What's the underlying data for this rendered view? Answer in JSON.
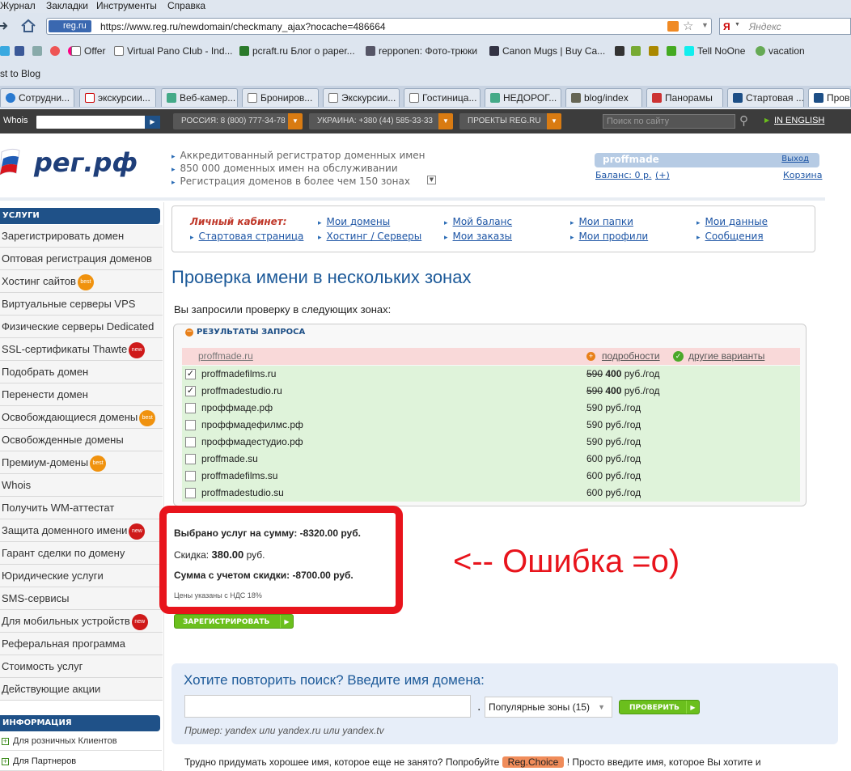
{
  "menu": [
    "Журнал",
    "Закладки",
    "Инструменты",
    "Справка"
  ],
  "nav": {
    "site_id": "reg.ru",
    "url": "https://www.reg.ru/newdomain/checkmany_ajax?nocache=486664",
    "search_placeholder": "Яндекс"
  },
  "bookmarks": [
    "Offer",
    "Virtual Pano Club - Ind...",
    "pcraft.ru Блог о paper...",
    "repponen: Фото-трюки",
    "Canon Mugs | Buy Ca...",
    "Tell NoOne",
    "vacation"
  ],
  "bookmarks_row2": "st to Blog",
  "tabs": [
    "Сотрудни...",
    "экскурсии...",
    "Веб-камер...",
    "Брониров...",
    "Экскурсии...",
    "Гостиница...",
    "НЕДОРОГ...",
    "blog/index",
    "Панорамы",
    "Стартовая ...",
    "Пров"
  ],
  "sitebar": {
    "whois": "Whois",
    "russia": "РОССИЯ: 8 (800) 777-34-78",
    "ukraine": "УКРАИНА: +380 (44) 585-33-33",
    "projects": "ПРОЕКТЫ REG.RU",
    "search_placeholder": "Поиск по сайту",
    "english": "IN ENGLISH"
  },
  "header": {
    "logo_text": "рег.рф",
    "lines": [
      "Аккредитованный регистратор доменных имен",
      "850 000 доменных имен на обслуживании",
      "Регистрация доменов в более чем 150 зонах"
    ],
    "username": "proffmade",
    "logout": "Выход",
    "balance": "Баланс: 0 р.",
    "balance_plus": "(+)",
    "cart": "Корзина"
  },
  "sidebar": {
    "services_title": "УСЛУГИ",
    "items": [
      {
        "label": "Зарегистрировать домен",
        "badge": ""
      },
      {
        "label": "Оптовая регистрация доменов",
        "badge": ""
      },
      {
        "label": "Хостинг сайтов",
        "badge": "best"
      },
      {
        "label": "Виртуальные серверы VPS",
        "badge": ""
      },
      {
        "label": "Физические серверы Dedicated",
        "badge": ""
      },
      {
        "label": "SSL-сертификаты Thawte",
        "badge": "new"
      },
      {
        "label": "Подобрать домен",
        "badge": ""
      },
      {
        "label": "Перенести домен",
        "badge": ""
      },
      {
        "label": "Освобождающиеся домены",
        "badge": "best"
      },
      {
        "label": "Освобожденные домены",
        "badge": ""
      },
      {
        "label": "Премиум-домены",
        "badge": "best"
      },
      {
        "label": "Whois",
        "badge": ""
      },
      {
        "label": "Получить WM-аттестат",
        "badge": ""
      },
      {
        "label": "Защита доменного имени",
        "badge": "new"
      },
      {
        "label": "Гарант сделки по домену",
        "badge": ""
      },
      {
        "label": "Юридические услуги",
        "badge": ""
      },
      {
        "label": "SMS-сервисы",
        "badge": ""
      },
      {
        "label": "Для мобильных устройств",
        "badge": "new"
      },
      {
        "label": "Реферальная программа",
        "badge": ""
      },
      {
        "label": "Стоимость услуг",
        "badge": ""
      },
      {
        "label": "Действующие акции",
        "badge": ""
      }
    ],
    "info_title": "ИНФОРМАЦИЯ",
    "info_items": [
      "Для розничных Клиентов",
      "Для Партнеров"
    ]
  },
  "cabinet": {
    "title": "Личный кабинет:",
    "links": [
      "Мои домены",
      "Мой баланс",
      "Мои папки",
      "Мои данные",
      "Стартовая страница",
      "Хостинг / Серверы",
      "Мои заказы",
      "Мои профили",
      "Сообщения"
    ]
  },
  "page_title": "Проверка имени в нескольких зонах",
  "requested_text": "Вы запросили проверку в следующих зонах:",
  "results": {
    "title": "РЕЗУЛЬТАТЫ ЗАПРОСА",
    "header_domain": "proffmade.ru",
    "details": "подробности",
    "other": "другие варианты",
    "rows": [
      {
        "domain": "proffmadefilms.ru",
        "checked": true,
        "old_price": "590",
        "price": "400",
        "unit": "руб./год"
      },
      {
        "domain": "proffmadestudio.ru",
        "checked": true,
        "old_price": "590",
        "price": "400",
        "unit": "руб./год"
      },
      {
        "domain": "проффмаде.рф",
        "checked": false,
        "old_price": "",
        "price": "590",
        "unit": "руб./год"
      },
      {
        "domain": "проффмадефилмс.рф",
        "checked": false,
        "old_price": "",
        "price": "590",
        "unit": "руб./год"
      },
      {
        "domain": "проффмадестудио.рф",
        "checked": false,
        "old_price": "",
        "price": "590",
        "unit": "руб./год"
      },
      {
        "domain": "proffmade.su",
        "checked": false,
        "old_price": "",
        "price": "600",
        "unit": "руб./год"
      },
      {
        "domain": "proffmadefilms.su",
        "checked": false,
        "old_price": "",
        "price": "600",
        "unit": "руб./год"
      },
      {
        "domain": "proffmadestudio.su",
        "checked": false,
        "old_price": "",
        "price": "600",
        "unit": "руб./год"
      }
    ]
  },
  "summary": {
    "selected": "Выбрано услуг на сумму: -8320.00 руб.",
    "discount_label": "Скидка:",
    "discount_value": "380.00",
    "discount_unit": "руб.",
    "total": "Сумма с учетом скидки: -8700.00 руб.",
    "vat_note": "Цены указаны с НДС 18%"
  },
  "error_annotation": "<-- Ошибка =о)",
  "register_button": "ЗАРЕГИСТРИРОВАТЬ",
  "repeat": {
    "title": "Хотите повторить поиск? Введите имя домена:",
    "dot": ".",
    "zones": "Популярные зоны (15)",
    "check_button": "ПРОВЕРИТЬ",
    "example": "Пример: yandex или yandex.ru или yandex.tv"
  },
  "bottom": {
    "before": "Трудно придумать хорошее имя, которое еще не занято? Попробуйте ",
    "reg_choice": "Reg.Choice",
    "after": " ! Просто введите имя, которое Вы хотите и"
  }
}
